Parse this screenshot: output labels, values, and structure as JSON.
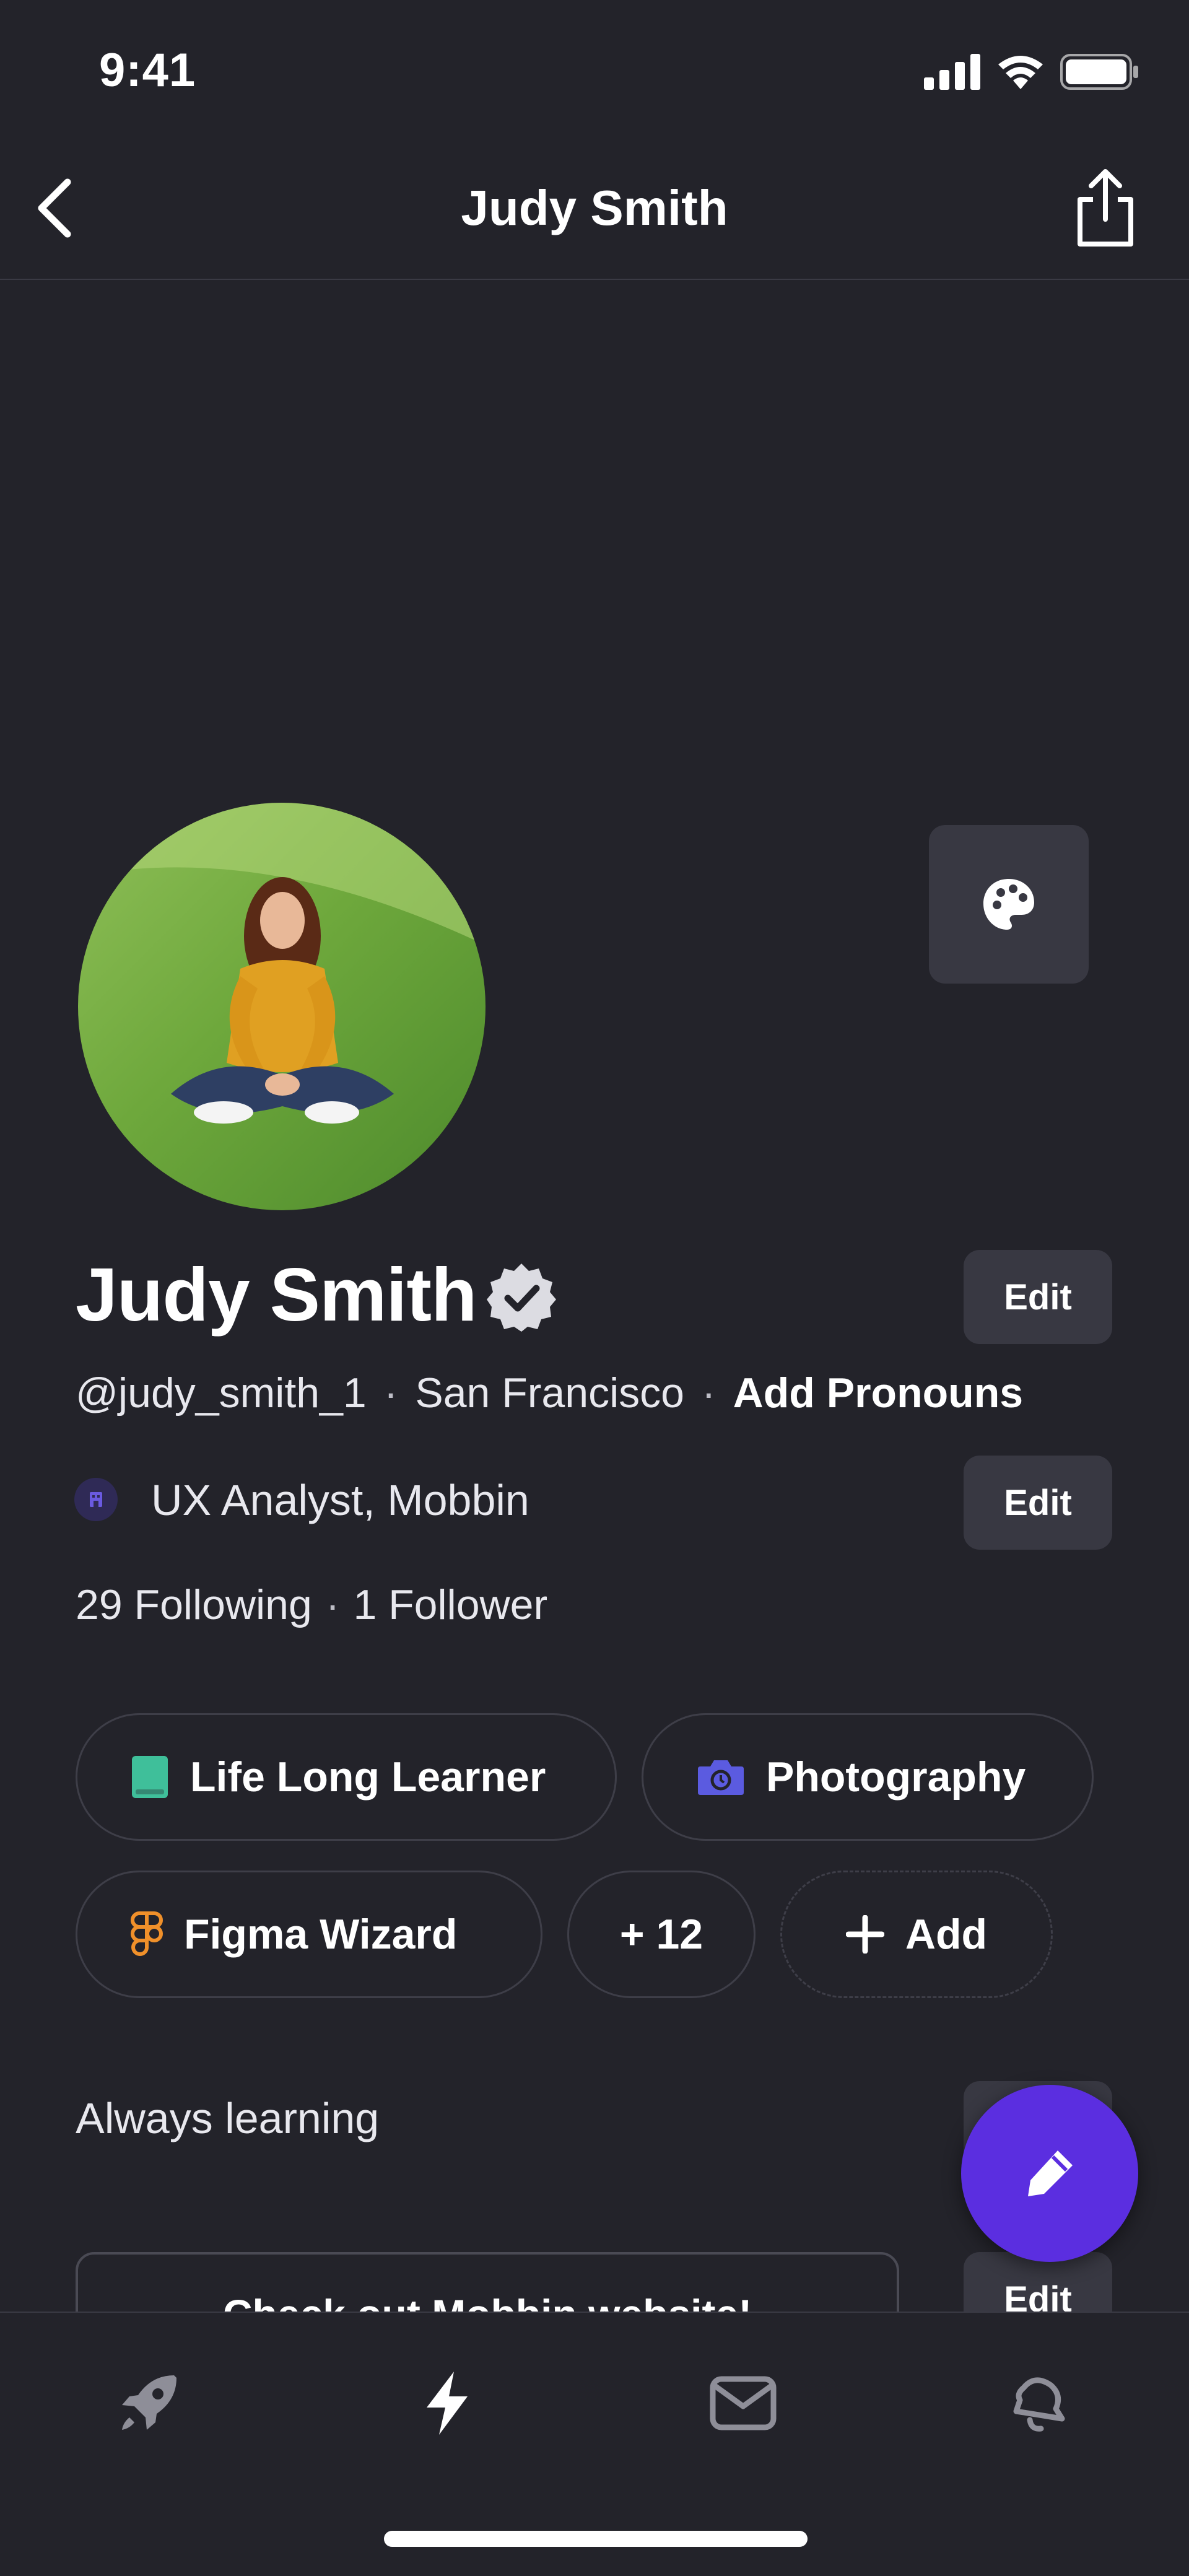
{
  "status_bar": {
    "time": "9:41"
  },
  "header": {
    "title": "Judy Smith"
  },
  "profile": {
    "name": "Judy Smith",
    "edit_label": "Edit",
    "handle": "@judy_smith_1",
    "location": "San Francisco",
    "pronouns_link": "Add Pronouns",
    "separator": "·",
    "job": "UX Analyst, Mobbin",
    "following": "29 Following",
    "followers": "1 Follower",
    "bio": "Always learning",
    "link_card": "Check out Mobbin website!"
  },
  "chips": {
    "learner": "Life Long Learner",
    "photography": "Photography",
    "figma": "Figma Wizard",
    "more": "+ 12",
    "add": "Add"
  },
  "icons": {
    "learner_icon_color": "#3fbf9a",
    "photo_icon_color": "#5b5be0",
    "figma_icon_color": "#f0902a",
    "fab_color": "#5b2ee0"
  }
}
